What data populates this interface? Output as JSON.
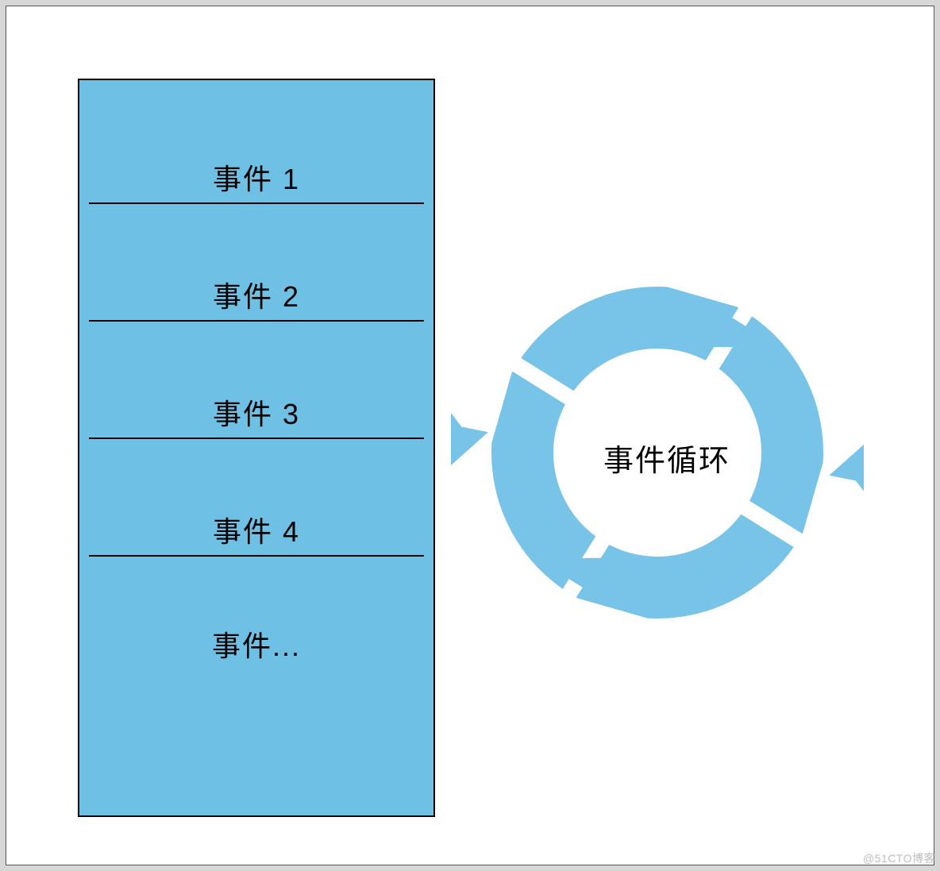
{
  "queue": {
    "items": [
      {
        "label": "事件 1"
      },
      {
        "label": "事件 2"
      },
      {
        "label": "事件 3"
      },
      {
        "label": "事件 4"
      },
      {
        "label": "事件..."
      }
    ]
  },
  "loop": {
    "label": "事件循环"
  },
  "watermark": "@51CTO博客",
  "colors": {
    "queue_fill": "#6ec1e4",
    "cycle_fill": "#78c3e8"
  }
}
